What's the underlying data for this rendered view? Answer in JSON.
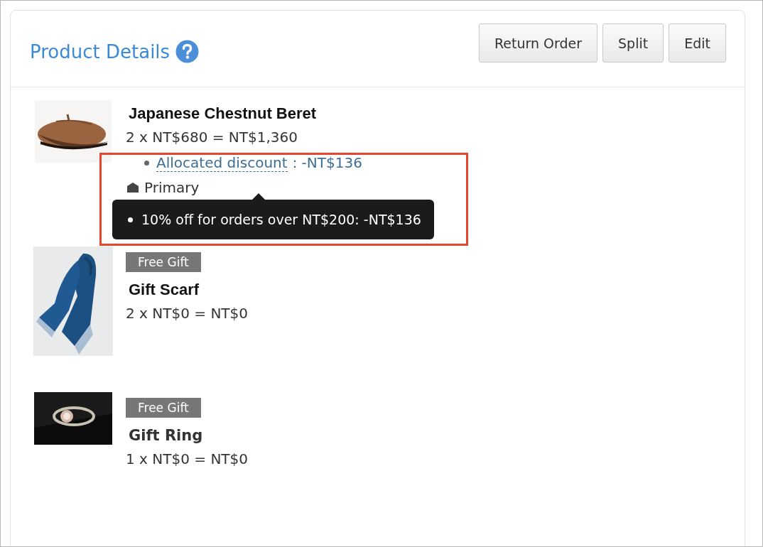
{
  "header": {
    "title": "Product Details",
    "buttons": [
      "Return Order",
      "Split",
      "Edit"
    ]
  },
  "products": [
    {
      "name": "Japanese Chestnut Beret",
      "price": "2 x NT$680 = NT$1,360",
      "discounts": [
        {
          "label": "Allocated discount",
          "amount": "：-NT$136"
        }
      ],
      "tag": "Primary",
      "tooltip": {
        "items": [
          "10% off for orders over NT$200: -NT$136"
        ]
      },
      "highlighted": true
    },
    {
      "badge": "Free Gift",
      "name": "Gift Scarf",
      "price": "2 x NT$0 = NT$0"
    },
    {
      "badge": "Free Gift",
      "name": "Gift Ring",
      "price": "1 x NT$0 = NT$0"
    }
  ]
}
